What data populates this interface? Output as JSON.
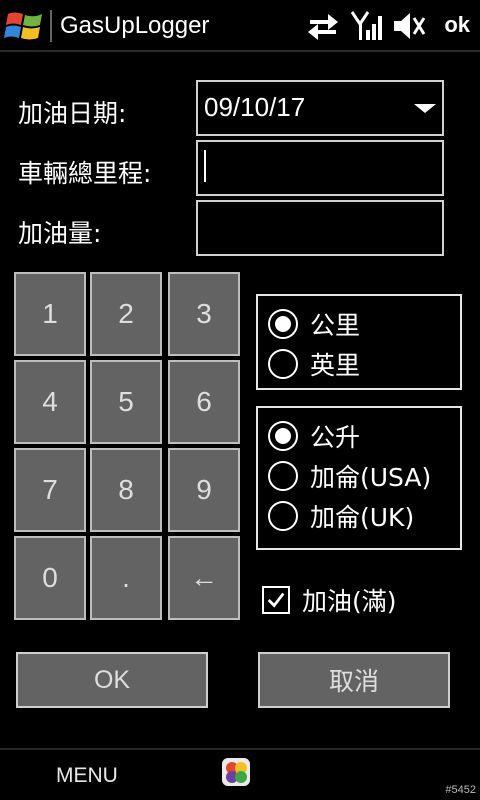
{
  "titlebar": {
    "app_title": "GasUpLogger",
    "ok_label": "ok"
  },
  "form": {
    "date_label": "加油日期:",
    "date_value": "09/10/17",
    "odometer_label": "車輛總里程:",
    "odometer_value": "",
    "amount_label": "加油量:",
    "amount_value": ""
  },
  "keypad": [
    "1",
    "2",
    "3",
    "4",
    "5",
    "6",
    "7",
    "8",
    "9",
    "0",
    ".",
    "←"
  ],
  "distance_units": {
    "options": [
      "公里",
      "英里"
    ],
    "selected": 0
  },
  "volume_units": {
    "options": [
      "公升",
      "加侖(USA)",
      "加侖(UK)"
    ],
    "selected": 0
  },
  "fill_checkbox": {
    "label": "加油(滿)",
    "checked": true
  },
  "buttons": {
    "ok": "OK",
    "cancel": "取消"
  },
  "bottombar": {
    "menu": "MENU",
    "build": "#5452"
  },
  "icons": [
    "windows-logo-icon",
    "data-transfer-icon",
    "signal-icon",
    "volume-muted-icon",
    "app-icon",
    "dropdown-arrow-icon",
    "checkmark-icon"
  ]
}
